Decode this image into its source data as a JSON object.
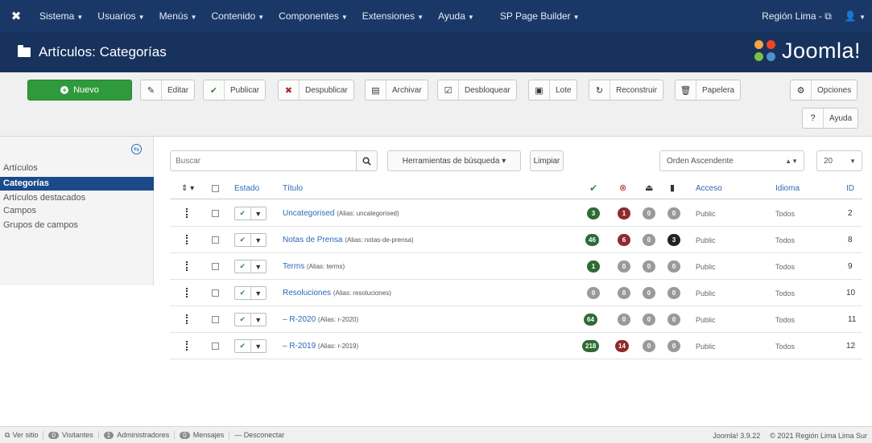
{
  "topnav": {
    "menus": [
      {
        "label": "Sistema"
      },
      {
        "label": "Usuarios"
      },
      {
        "label": "Menús"
      },
      {
        "label": "Contenido"
      },
      {
        "label": "Componentes"
      },
      {
        "label": "Extensiones"
      },
      {
        "label": "Ayuda"
      },
      {
        "label": "SP Page Builder"
      }
    ],
    "site_link": "Región Lima -",
    "site_icon": "external-link-icon",
    "user_icon": "user-icon"
  },
  "header": {
    "title": "Artículos: Categorías",
    "brand": "Joomla!"
  },
  "toolbar": {
    "new": "Nuevo",
    "edit": "Editar",
    "publish": "Publicar",
    "unpublish": "Despublicar",
    "archive": "Archivar",
    "checkin": "Desbloquear",
    "batch": "Lote",
    "rebuild": "Reconstruir",
    "trash": "Papelera",
    "options": "Opciones",
    "help": "Ayuda"
  },
  "sidebar": {
    "items": [
      {
        "label": "Artículos"
      },
      {
        "label": "Categorías"
      },
      {
        "label": "Artículos destacados"
      },
      {
        "label": "Campos"
      },
      {
        "label": "Grupos de campos"
      }
    ]
  },
  "filters": {
    "search_placeholder": "Buscar",
    "search_tools": "Herramientas de búsqueda ▾",
    "clear": "Limpiar",
    "ordering": "Orden Ascendente",
    "limit": "20"
  },
  "table": {
    "headers": {
      "order": "⇕ ▾",
      "status": "Estado",
      "title": "Título",
      "access": "Acceso",
      "language": "Idioma",
      "id": "ID"
    },
    "rows": [
      {
        "title": "Uncategorised",
        "alias": "(Alias: uncategorised)",
        "published": "3",
        "unpublished": "1",
        "archived": "0",
        "trashed": "0",
        "access": "Public",
        "language": "Todos",
        "id": "2"
      },
      {
        "title": "Notas de Prensa",
        "alias": "(Alias: notas-de-prensa)",
        "published": "46",
        "unpublished": "6",
        "archived": "0",
        "trashed": "3",
        "access": "Public",
        "language": "Todos",
        "id": "8"
      },
      {
        "title": "Terms",
        "alias": "(Alias: terms)",
        "published": "1",
        "unpublished": "0",
        "archived": "0",
        "trashed": "0",
        "access": "Public",
        "language": "Todos",
        "id": "9"
      },
      {
        "title": "Resoluciones",
        "alias": "(Alias: resoluciones)",
        "published": "0",
        "unpublished": "0",
        "archived": "0",
        "trashed": "0",
        "access": "Public",
        "language": "Todos",
        "id": "10"
      },
      {
        "title": "– R-2020",
        "alias": "(Alias: r-2020)",
        "published": "64",
        "unpublished": "0",
        "archived": "0",
        "trashed": "0",
        "access": "Public",
        "language": "Todos",
        "id": "11"
      },
      {
        "title": "– R-2019",
        "alias": "(Alias: r-2019)",
        "published": "218",
        "unpublished": "14",
        "archived": "0",
        "trashed": "0",
        "access": "Public",
        "language": "Todos",
        "id": "12"
      }
    ]
  },
  "footer": {
    "view_site": "Ver sitio",
    "visitors_count": "0",
    "visitors": "Visitantes",
    "admins_count": "1",
    "admins": "Administradores",
    "messages_count": "0",
    "messages": "Mensajes",
    "logout": "— Desconectar",
    "version": "Joomla! 3.9.22",
    "copyright": "© 2021 Región Lima  Lima Sur"
  }
}
